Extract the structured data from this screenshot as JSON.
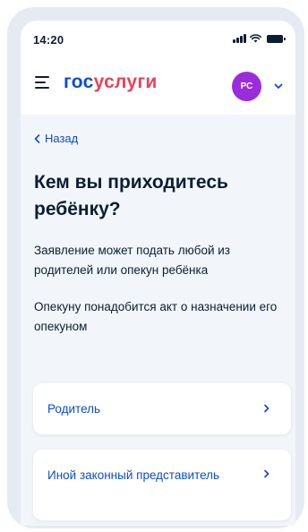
{
  "status_bar": {
    "time": "14:20"
  },
  "header": {
    "logo_part1": "гос",
    "logo_part2": "услуги",
    "avatar_initials": "РС"
  },
  "main": {
    "back_label": "Назад",
    "title": "Кем вы приходитесь ребёнку?",
    "description_1": "Заявление может подать любой из родителей или опекун ребёнка",
    "description_2": "Опекуну понадобится акт о назначении его опекуном",
    "options": [
      {
        "label": "Родитель"
      },
      {
        "label": "Иной законный представитель"
      }
    ]
  },
  "colors": {
    "accent": "#0d4cd3",
    "logo_red": "#ee3f58",
    "avatar": "#9b2cdb",
    "text": "#0b1f33",
    "background": "#f2f6fa"
  },
  "icons": [
    "signal-icon",
    "wifi-icon",
    "battery-icon",
    "hamburger-icon",
    "chevron-down-icon",
    "chevron-left-icon",
    "chevron-right-icon"
  ]
}
